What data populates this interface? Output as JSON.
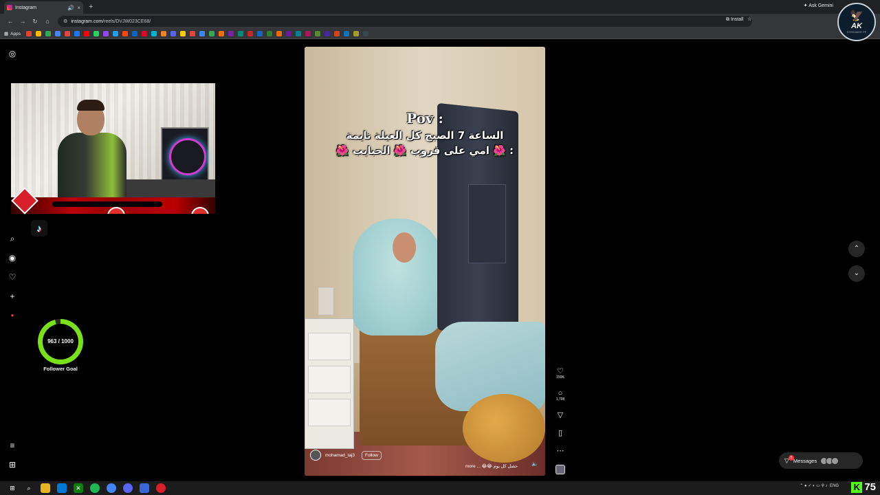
{
  "browser": {
    "tab_title": "Instagram",
    "tab_close": "×",
    "new_tab": "+",
    "url_host": "instagram.com",
    "url_path": "/reels/DVJW023CE68/",
    "install_label": "Install",
    "ask_gemini": "Ask Gemini",
    "apps_label": "Apps",
    "bookmark_colors": [
      "#e34133",
      "#fbbc04",
      "#34a853",
      "#4285f4",
      "#ea4335",
      "#1877f2",
      "#ff0000",
      "#25d366",
      "#9146ff",
      "#1da1f2",
      "#ff4500",
      "#0a66c2",
      "#e60023",
      "#00b4d8",
      "#f48024",
      "#5865f2",
      "#ffcc00",
      "#ea4335",
      "#4285f4",
      "#34a853",
      "#ff6d00",
      "#7b1fa2",
      "#00897b",
      "#c62828",
      "#1565c0",
      "#2e7d32",
      "#ef6c00",
      "#6a1b9a",
      "#00838f",
      "#ad1457",
      "#558b2f",
      "#4527a0",
      "#d84315",
      "#0277bd",
      "#9e9d24",
      "#37474f"
    ]
  },
  "logo": {
    "text": "AK",
    "subtitle": "STREAMER PP"
  },
  "overlay": {
    "follower_goal": {
      "current": 963,
      "target": 1000,
      "text": "963 / 1000",
      "label": "Follower Goal"
    }
  },
  "reel": {
    "caption": {
      "pov": "Pov :",
      "line1": "الساعة 7 الصبح كل العيلة نايمة",
      "line2": ": 🌺 امي على قروب 🌺 الحبايب 🌺"
    },
    "username": "mohamad_taj3",
    "follow_label": "Follow",
    "description": "حصل كل يوم 😂😂 ... more",
    "likes": "159K",
    "comments": "1,798"
  },
  "messages": {
    "label": "Messages",
    "badge": "5"
  },
  "taskbar": {
    "tray_text": "ENG",
    "kick_count": "75"
  }
}
